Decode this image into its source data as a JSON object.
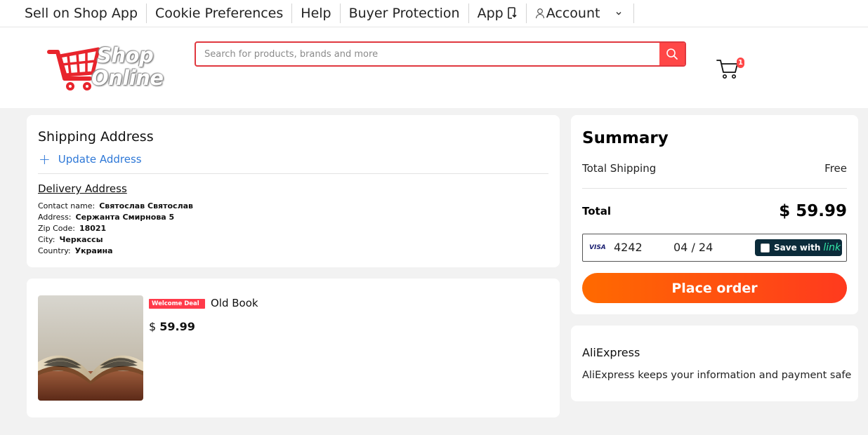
{
  "topnav": {
    "items": [
      {
        "label": "Sell on Shop App"
      },
      {
        "label": "Cookie Preferences"
      },
      {
        "label": "Help"
      },
      {
        "label": "Buyer Protection"
      },
      {
        "label": "App"
      },
      {
        "label": "Account"
      }
    ]
  },
  "header": {
    "logo_line1": "Shop",
    "logo_line2": "Online",
    "search_placeholder": "Search for products, brands and more",
    "cart_count": "1"
  },
  "shipping": {
    "title": "Shipping Address",
    "update_label": "Update Address",
    "delivery_title": "Delivery Address",
    "fields": [
      {
        "label": "Contact name:",
        "value": "Святослав Святослав"
      },
      {
        "label": "Address:",
        "value": "Сержанта Смирнова 5"
      },
      {
        "label": "Zip Code:",
        "value": "18021"
      },
      {
        "label": "City:",
        "value": "Черкассы"
      },
      {
        "label": "Country:",
        "value": "Украина"
      }
    ]
  },
  "product": {
    "badge": "Welcome Deal",
    "name": "Old Book",
    "currency": "$",
    "price": "59.99"
  },
  "summary": {
    "title": "Summary",
    "shipping_label": "Total Shipping",
    "shipping_value": "Free",
    "total_label": "Total",
    "total_value": "$ 59.99",
    "card_brand": "VISA",
    "card_last4": "4242",
    "card_expiry": "04 / 24",
    "save_with": "Save with",
    "link_word": "link",
    "place_order": "Place order"
  },
  "trust": {
    "title": "AliExpress",
    "text": "AliExpress keeps your information and payment safe"
  },
  "colors": {
    "accent_red": "#ff4747",
    "link_blue": "#2e78d7",
    "order_gradient_start": "#ff6a00",
    "order_gradient_end": "#ff3a1e"
  }
}
